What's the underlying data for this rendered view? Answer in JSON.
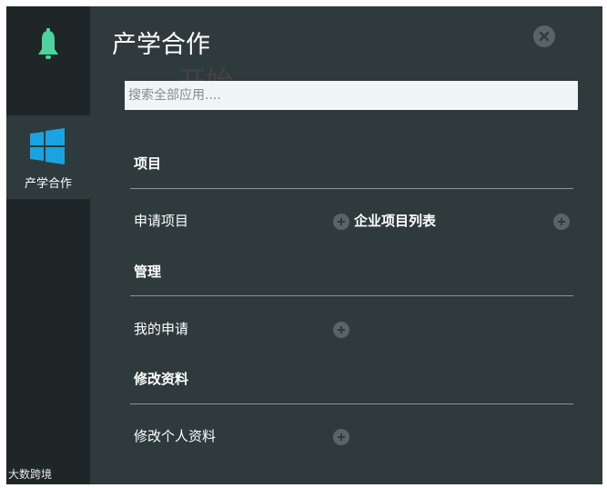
{
  "sidebar": {
    "nav_label": "产学合作",
    "watermark": "大数跨境"
  },
  "header": {
    "title": "产学合作",
    "faint_overlay": "开始"
  },
  "search": {
    "placeholder": "搜索全部应用...."
  },
  "sections": [
    {
      "title": "项目",
      "items": [
        "申请项目",
        "企业项目列表"
      ]
    },
    {
      "title": "管理",
      "items": [
        "我的申请"
      ]
    },
    {
      "title": "修改资料",
      "items": [
        "修改个人资料"
      ]
    }
  ],
  "colors": {
    "panel": "#2f3a3c",
    "sidebar": "#1f2628",
    "bell": "#4dd2a0",
    "windows_logo": "#1aa3e0",
    "plus_badge": "#5a6466"
  },
  "icons": [
    "bell-icon",
    "windows-logo-icon",
    "close-icon",
    "plus-icon"
  ]
}
